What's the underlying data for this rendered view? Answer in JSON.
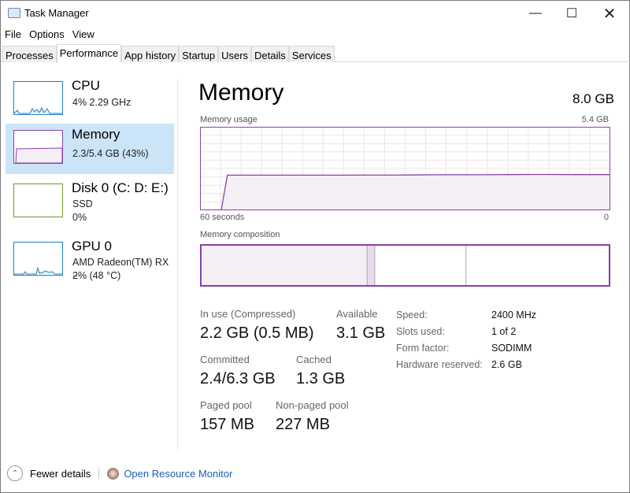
{
  "window": {
    "title": "Task Manager",
    "minimize_icon": "minimize-icon",
    "maximize_icon": "maximize-icon",
    "close_icon": "close-icon"
  },
  "menu": [
    "File",
    "Options",
    "View"
  ],
  "tabs": [
    {
      "label": "Processes"
    },
    {
      "label": "Performance",
      "active": true
    },
    {
      "label": "App history"
    },
    {
      "label": "Startup"
    },
    {
      "label": "Users"
    },
    {
      "label": "Details"
    },
    {
      "label": "Services"
    }
  ],
  "sidebar": [
    {
      "title": "CPU",
      "lines": [
        "4%  2.29 GHz"
      ],
      "color": "#1f7fc4"
    },
    {
      "title": "Memory",
      "lines": [
        "2.3/5.4 GB (43%)"
      ],
      "color": "#8b3fa8",
      "selected": true
    },
    {
      "title": "Disk 0 (C: D: E:)",
      "lines": [
        "SSD",
        "0%"
      ],
      "color": "#6b9a2c"
    },
    {
      "title": "GPU 0",
      "lines": [
        "AMD Radeon(TM) RX ...",
        "2%  (48 °C)"
      ],
      "color": "#1f7fc4"
    }
  ],
  "main": {
    "title": "Memory",
    "total": "8.0 GB",
    "usage_label": "Memory usage",
    "usage_max": "5.4 GB",
    "x_left": "60 seconds",
    "x_right": "0",
    "composition_label": "Memory composition",
    "stats": [
      {
        "label": "In use (Compressed)",
        "value": "2.2 GB (0.5 MB)"
      },
      {
        "label": "Available",
        "value": "3.1 GB"
      },
      {
        "label": "Committed",
        "value": "2.4/6.3 GB"
      },
      {
        "label": "Cached",
        "value": "1.3 GB"
      },
      {
        "label": "Paged pool",
        "value": "157 MB"
      },
      {
        "label": "Non-paged pool",
        "value": "227 MB"
      }
    ],
    "details": [
      {
        "label": "Speed:",
        "value": "2400 MHz"
      },
      {
        "label": "Slots used:",
        "value": "1 of 2"
      },
      {
        "label": "Form factor:",
        "value": "SODIMM"
      },
      {
        "label": "Hardware reserved:",
        "value": "2.6 GB"
      }
    ]
  },
  "chart_data": {
    "type": "area",
    "title": "Memory usage",
    "x_unit": "seconds ago",
    "xlim": [
      60,
      0
    ],
    "ylim": [
      0,
      5.4
    ],
    "y_unit": "GB",
    "grid": true,
    "points": [
      [
        60,
        0
      ],
      [
        56.9,
        0
      ],
      [
        56,
        2.27
      ],
      [
        40,
        2.27
      ],
      [
        30,
        2.28
      ],
      [
        25,
        2.3
      ],
      [
        20,
        2.3
      ],
      [
        15,
        2.31
      ],
      [
        10,
        2.32
      ],
      [
        5,
        2.31
      ],
      [
        0,
        2.31
      ]
    ],
    "composition": [
      {
        "name": "In use",
        "value": 2.2
      },
      {
        "name": "Modified",
        "value": 0.1
      },
      {
        "name": "Standby",
        "value": 1.2
      },
      {
        "name": "Free",
        "value": 1.9
      }
    ],
    "color": "#8b3fa8",
    "fill": "#f4eff5"
  },
  "footer": {
    "fewer": "Fewer details",
    "monitor": "Open Resource Monitor",
    "chevron_icon": "chevron-up-icon",
    "monitor_icon": "resource-monitor-icon"
  }
}
